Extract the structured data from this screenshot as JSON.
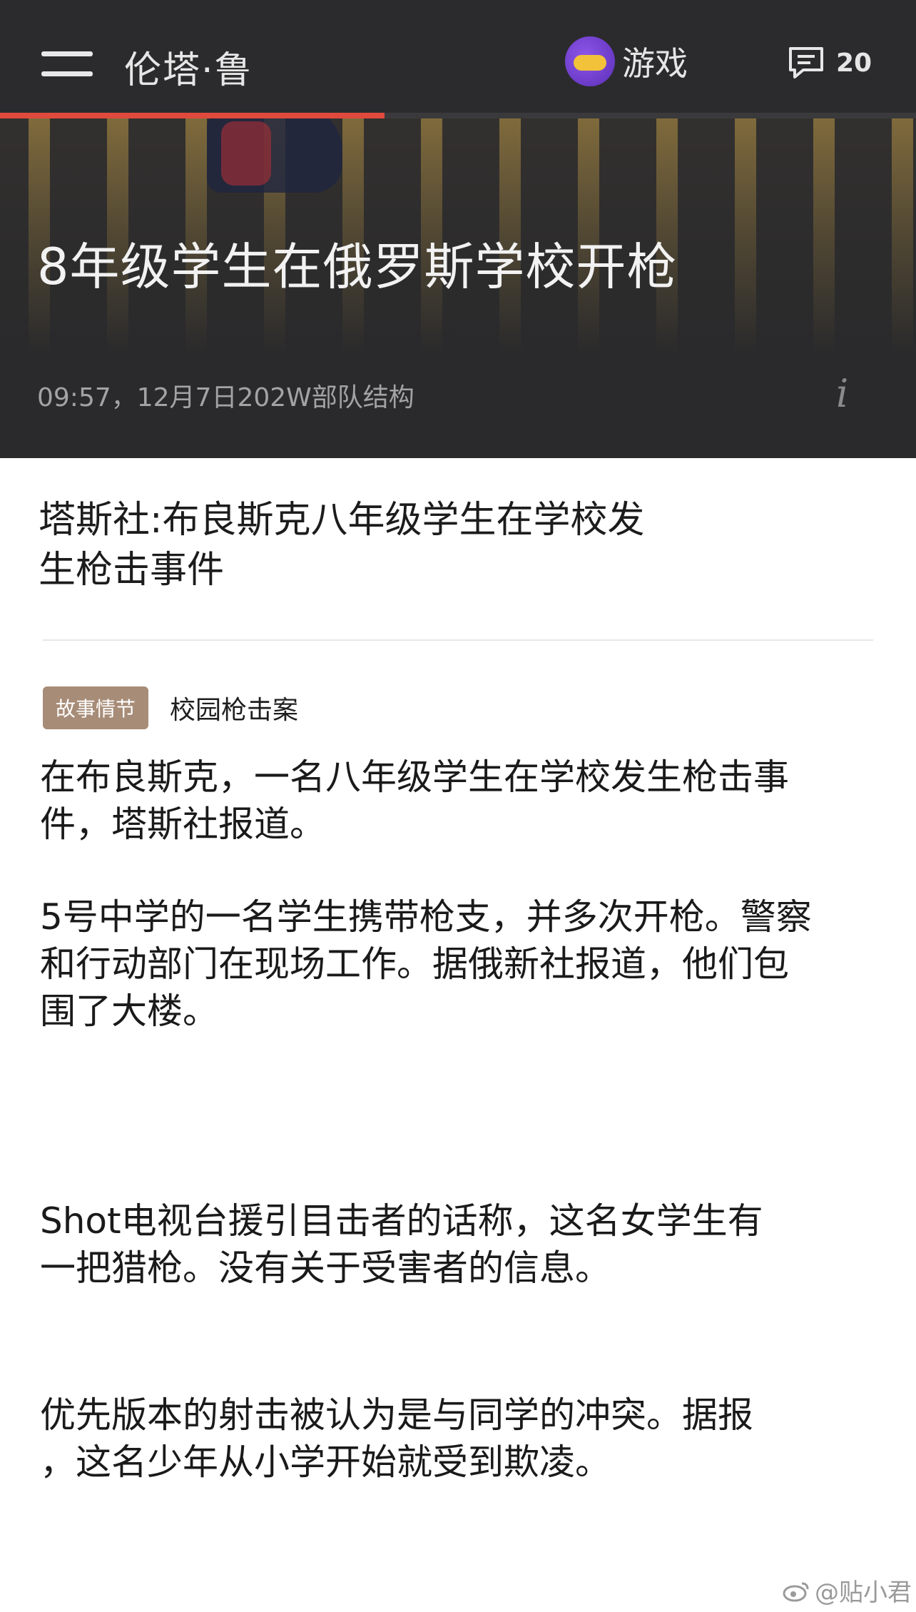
{
  "topbar": {
    "brand": "伦塔·鲁",
    "game_label": "游戏",
    "comment_count": "20",
    "reading_progress": 0.42
  },
  "hero": {
    "title": "8年级学生在俄罗斯学校开枪",
    "meta": "09:57，12月7日202W部队结构"
  },
  "article": {
    "headline_line1": "塔斯社:布良斯克八年级学生在学校发",
    "headline_line2": "生枪击事件",
    "tag_badge": "故事情节",
    "tag_text": "校园枪击案",
    "paragraphs": [
      [
        "在布良斯克，一名八年级学生在学校发生枪击事",
        "件，塔斯社报道。"
      ],
      [
        "5号中学的一名学生携带枪支，并多次开枪。警察",
        "和行动部门在现场工作。据俄新社报道，他们包",
        "围了大楼。"
      ],
      [
        "Shot电视台援引目击者的话称，这名女学生有",
        "一把猎枪。没有关于受害者的信息。"
      ],
      [
        "优先版本的射击被认为是与同学的冲突。据报",
        "，这名少年从小学开始就受到欺凌。"
      ]
    ]
  },
  "watermark": "@贴小君",
  "colors": {
    "header_bg": "#2b2b2d",
    "progress": "#e04a3c",
    "tag_badge": "#a78c77"
  }
}
